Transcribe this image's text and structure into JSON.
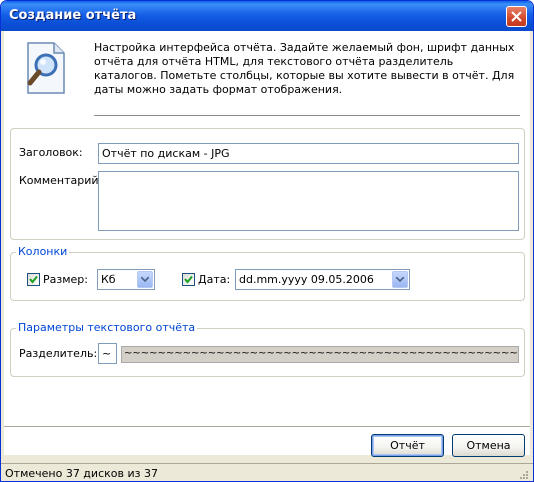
{
  "window": {
    "title": "Создание отчёта"
  },
  "header": {
    "description": "Настройка интерфейса отчёта. Задайте желаемый фон, шрифт данных отчёта для отчёта HTML, для текстового отчёта разделитель каталогов. Пометьте столбцы, которые вы хотите вывести в отчёт. Для даты можно задать формат отображения.",
    "icon": "document-magnifier-icon"
  },
  "form": {
    "title_label": "Заголовок:",
    "title_value": "Отчёт по дискам - JPG",
    "comment_label": "Комментарий:",
    "comment_value": ""
  },
  "columns_group": {
    "legend": "Колонки",
    "size_checked": true,
    "size_label": "Размер:",
    "size_unit": "Кб",
    "date_checked": true,
    "date_label": "Дата:",
    "date_format": "dd.mm.yyyy 09.05.2006"
  },
  "text_report_group": {
    "legend": "Параметры текстового отчёта",
    "separator_label": "Разделитель:",
    "separator_value": "~",
    "separator_preview": "~~~~~~~~~~~~~~~~~~~~~~~~~~~~~~~~~~~~~~~~~~~~~~~~~~~~~~~~~~~~~~~~~~~~~~~"
  },
  "buttons": {
    "ok": "Отчёт",
    "cancel": "Отмена"
  },
  "status": {
    "text": "Отмечено 37 дисков из 37"
  },
  "colors": {
    "titlebar": "#0b4fd6",
    "group_legend": "#0046d5",
    "face": "#ece9d8",
    "close": "#d2482b"
  }
}
